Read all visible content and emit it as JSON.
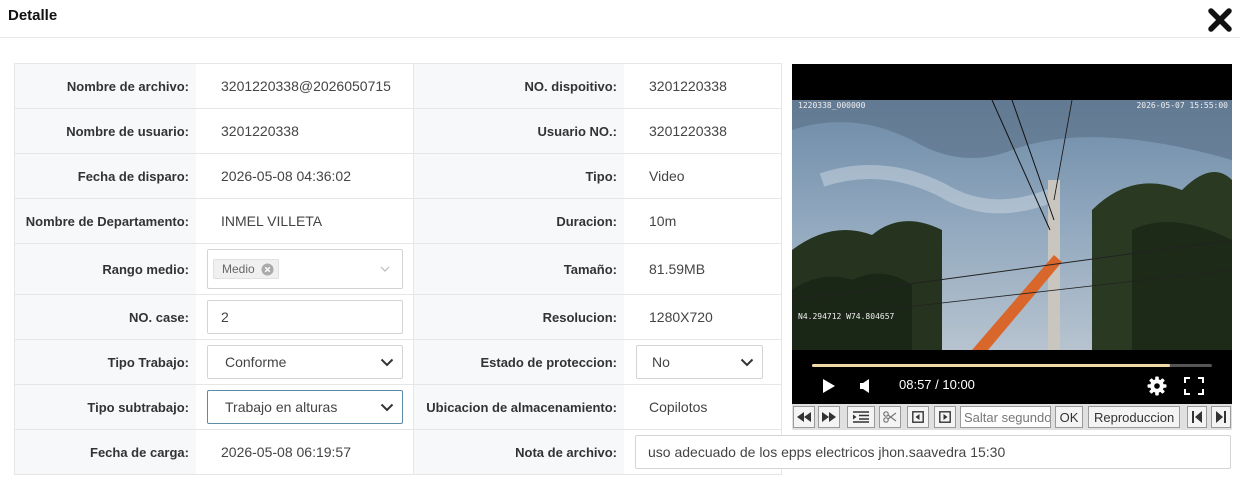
{
  "dialog": {
    "title": "Detalle"
  },
  "detail": {
    "rows": [
      {
        "label_left": "Nombre de archivo:",
        "value_left": "3201220338@2026050715",
        "label_right": "NO. dispoitivo:",
        "value_right": "3201220338"
      },
      {
        "label_left": "Nombre de usuario:",
        "value_left": "3201220338",
        "label_right": "Usuario NO.:",
        "value_right": "3201220338"
      },
      {
        "label_left": "Fecha de disparo:",
        "value_left": "2026-05-08 04:36:02",
        "label_right": "Tipo:",
        "value_right": "Video"
      },
      {
        "label_left": "Nombre de Departamento:",
        "value_left": "INMEL VILLETA",
        "label_right": "Duracion:",
        "value_right": "10m"
      },
      {
        "label_left": "Rango medio:",
        "value_left": "Medio",
        "label_right": "Tamaño:",
        "value_right": "81.59MB"
      },
      {
        "label_left": "NO. case:",
        "value_left": "2",
        "label_right": "Resolucion:",
        "value_right": "1280X720"
      },
      {
        "label_left": "Tipo Trabajo:",
        "value_left": "Conforme",
        "label_right": "Estado de proteccion:",
        "value_right": "No"
      },
      {
        "label_left": "Tipo subtrabajo:",
        "value_left": "Trabajo en alturas",
        "label_right": "Ubicacion de almacenamiento:",
        "value_right": "Copilotos"
      },
      {
        "label_left": "Fecha de carga:",
        "value_left": "2026-05-08 06:19:57",
        "label_right": "Nota de archivo:",
        "value_right": "uso adecuado de los epps electricos jhon.saavedra 15:30"
      }
    ]
  },
  "video": {
    "osd_top_left": "1220338_000000",
    "osd_top_right": "2026-05-07 15:55:00",
    "osd_coords": "N4.294712 W74.804657",
    "time_display": "08:57 / 10:00",
    "progress_fraction": 0.895
  },
  "toolbar": {
    "seek_placeholder": "Saltar segundo",
    "ok_label": "OK",
    "playback_label": "Reproduccion"
  },
  "colors": {
    "progress_fill": "#f3d8a8",
    "active_border": "#5c8ba8"
  }
}
